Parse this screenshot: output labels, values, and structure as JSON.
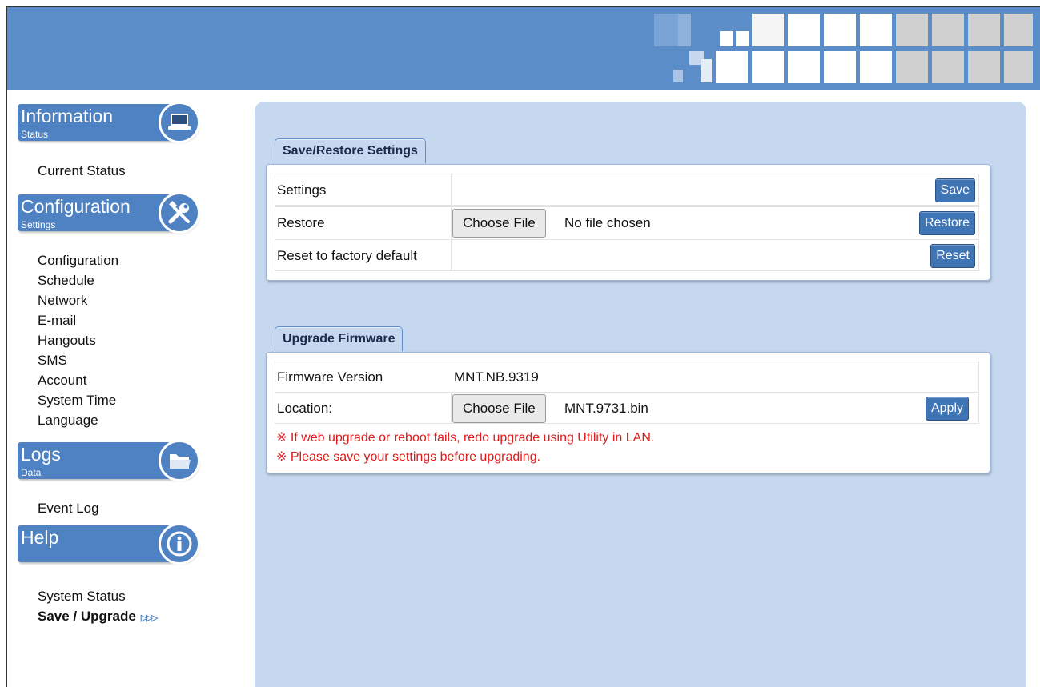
{
  "colors": {
    "header": "#5b8dc9",
    "accent": "#4f82c2",
    "panel": "#c5d8f0",
    "warning": "#e0191b"
  },
  "sidebar": {
    "sections": [
      {
        "title": "Information",
        "sub": "Status",
        "icon": "laptop-icon",
        "links": [
          "Current Status"
        ]
      },
      {
        "title": "Configuration",
        "sub": "Settings",
        "icon": "tools-icon",
        "links": [
          "Configuration",
          "Schedule",
          "Network",
          "E-mail",
          "Hangouts",
          "SMS",
          "Account",
          "System Time",
          "Language"
        ]
      },
      {
        "title": "Logs",
        "sub": "Data",
        "icon": "folder-icon",
        "links": [
          "Event Log"
        ]
      },
      {
        "title": "Help",
        "sub": "",
        "icon": "info-icon",
        "links": [
          "System Status",
          "Save / Upgrade"
        ]
      }
    ],
    "current": "Save / Upgrade"
  },
  "save_restore": {
    "tab": "Save/Restore Settings",
    "rows": [
      {
        "label": "Settings",
        "button": "Save"
      },
      {
        "label": "Restore",
        "choose": "Choose File",
        "file": "No file chosen",
        "button": "Restore"
      },
      {
        "label": "Reset to factory default",
        "button": "Reset"
      }
    ]
  },
  "firmware": {
    "tab": "Upgrade Firmware",
    "version_label": "Firmware Version",
    "version_value": "MNT.NB.9319",
    "location_label": "Location:",
    "choose": "Choose File",
    "file": "MNT.9731.bin",
    "button": "Apply",
    "notes": [
      "※ If web upgrade or reboot fails, redo upgrade using Utility in LAN.",
      "※ Please save your settings before upgrading."
    ]
  }
}
